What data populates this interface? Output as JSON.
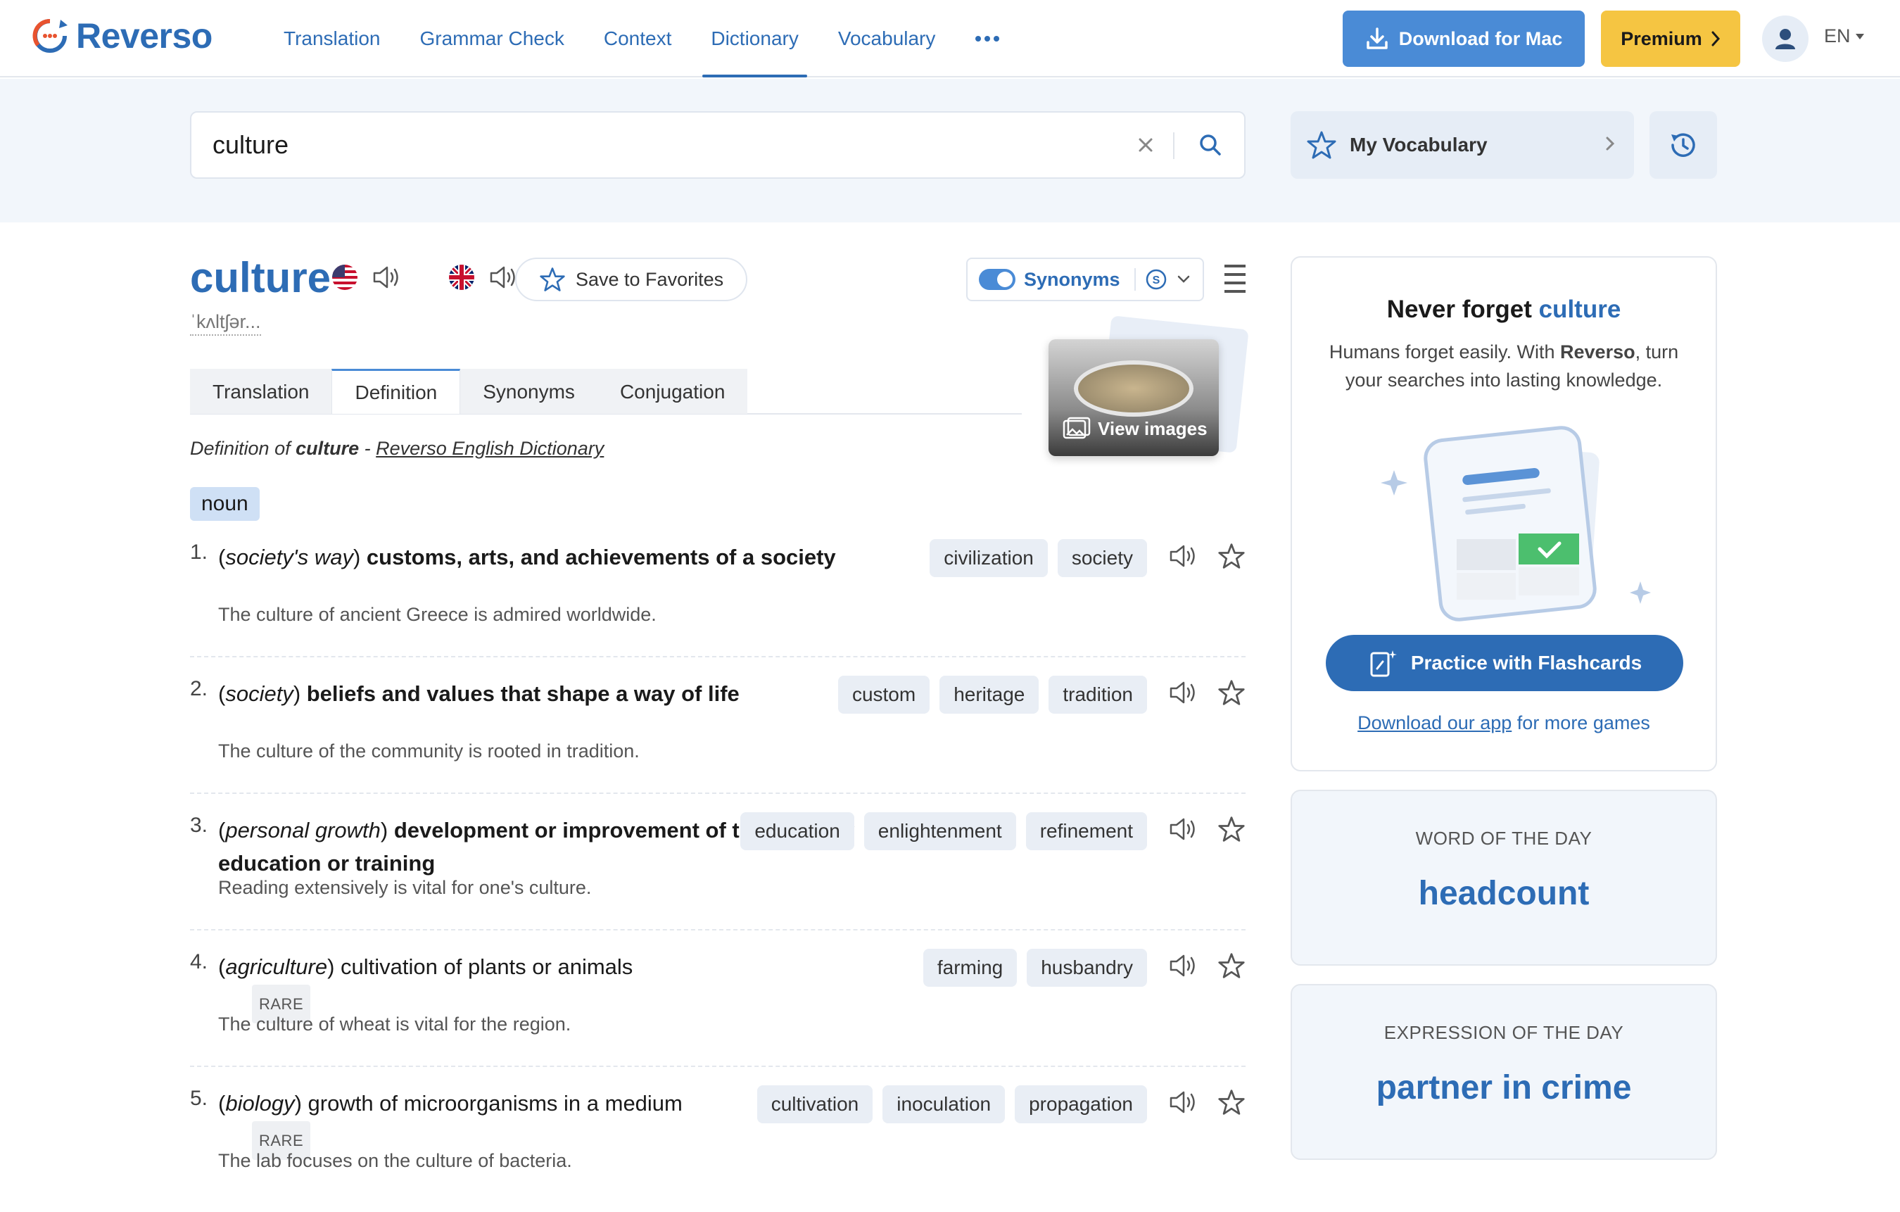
{
  "brand": {
    "name": "Reverso",
    "accent": "#2d6cb5",
    "premium_color": "#f5c542"
  },
  "nav": {
    "links": [
      "Translation",
      "Grammar Check",
      "Context",
      "Dictionary",
      "Vocabulary"
    ],
    "active": "Dictionary",
    "more_icon": "ellipsis-icon",
    "download_label": "Download for Mac",
    "premium_label": "Premium",
    "language": "EN"
  },
  "search": {
    "value": "culture",
    "placeholder": "",
    "my_vocabulary_label": "My Vocabulary"
  },
  "entry": {
    "headword": "culture",
    "phonetic": "ˈkʌltʃər...",
    "save_label": "Save to Favorites",
    "synonyms_toggle_label": "Synonyms",
    "synonyms_toggle_on": true,
    "tabs": [
      "Translation",
      "Definition",
      "Synonyms",
      "Conjugation"
    ],
    "active_tab": "Definition",
    "view_images_label": "View images",
    "source_prefix": "Definition of",
    "source_word": "culture",
    "source_sep": "-",
    "source_link": "Reverso English Dictionary",
    "part_of_speech": "noun"
  },
  "senses": [
    {
      "num": "1.",
      "domain": "society's way",
      "definition": "customs, arts, and achievements of a society",
      "definition_bold": true,
      "rare": "",
      "example": "The culture of ancient Greece is admired worldwide.",
      "synonyms": [
        "civilization",
        "society"
      ]
    },
    {
      "num": "2.",
      "domain": "society",
      "definition": "beliefs and values that shape a way of life",
      "definition_bold": true,
      "rare": "",
      "example": "The culture of the community is rooted in tradition.",
      "synonyms": [
        "custom",
        "heritage",
        "tradition"
      ]
    },
    {
      "num": "3.",
      "domain": "personal growth",
      "definition": "development or improvement of the mind by education or training",
      "definition_bold": true,
      "rare": "",
      "example": "Reading extensively is vital for one's culture.",
      "synonyms": [
        "education",
        "enlightenment",
        "refinement"
      ]
    },
    {
      "num": "4.",
      "domain": "agriculture",
      "definition": "cultivation of plants or animals",
      "definition_bold": false,
      "rare": "RARE",
      "example": "The culture of wheat is vital for the region.",
      "synonyms": [
        "farming",
        "husbandry"
      ]
    },
    {
      "num": "5.",
      "domain": "biology",
      "definition": "growth of microorganisms in a medium",
      "definition_bold": false,
      "rare": "RARE",
      "example": "The lab focuses on the culture of bacteria.",
      "synonyms": [
        "cultivation",
        "inoculation",
        "propagation"
      ]
    }
  ],
  "promo": {
    "title_prefix": "Never forget",
    "title_word": "culture",
    "subtitle_before": "Humans forget easily. With",
    "subtitle_brand": "Reverso",
    "subtitle_after": ", turn your searches into lasting knowledge.",
    "button_label": "Practice with Flashcards",
    "link_text": "Download our app",
    "link_after": "for more games"
  },
  "word_of_day": {
    "label": "WORD OF THE DAY",
    "word": "headcount"
  },
  "expression_of_day": {
    "label": "EXPRESSION OF THE DAY",
    "word": "partner in crime"
  }
}
